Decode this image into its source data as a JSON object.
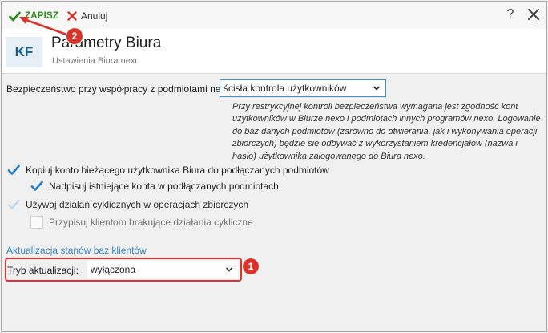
{
  "toolbar": {
    "save_label": "ZAPISZ",
    "cancel_label": "Anuluj",
    "help_label": "?"
  },
  "header": {
    "logo": "KF",
    "title": "Parametry Biura",
    "subtitle": "Ustawienia Biura nexo"
  },
  "security": {
    "label": "Bezpieczeństwo przy współpracy z podmiotami nexo:",
    "value": "ścisła kontrola użytkowników",
    "description": "Przy restrykcyjnej kontroli bezpieczeństwa wymagana jest zgodność kont użytkowników w Biurze nexo i podmiotach innych programów nexo. Logowanie do baz danych podmiotów (zarówno do otwierania, jak i wykonywania operacji zbiorczych) będzie się odbywać z wykorzystaniem kredencjałów (nazwa i hasło) użytkownika zalogowanego do Biura nexo."
  },
  "options": {
    "copy_account": {
      "label": "Kopiuj konto bieżącego użytkownika Biura do podłączanych podmiotów",
      "checked": true
    },
    "overwrite_accounts": {
      "label": "Nadpisuj istniejące konta w podłączanych podmiotach",
      "checked": true
    },
    "use_cyclic": {
      "label": "Używaj działań cyklicznych w operacjach zbiorczych",
      "checked": true,
      "dimmed": true
    },
    "assign_missing": {
      "label": "Przypisuj klientom brakujące działania cykliczne",
      "checked": false,
      "disabled": true
    }
  },
  "update_section": {
    "title": "Aktualizacja stanów baz klientów",
    "mode_label": "Tryb aktualizacji:",
    "mode_value": "wyłączona"
  },
  "annotations": {
    "badge_1": "1",
    "badge_2": "2"
  },
  "colors": {
    "accent_blue": "#3a86c8",
    "save_green": "#2e8b1e",
    "annotation_red": "#d9342b",
    "logo_text": "#1b5f84"
  }
}
